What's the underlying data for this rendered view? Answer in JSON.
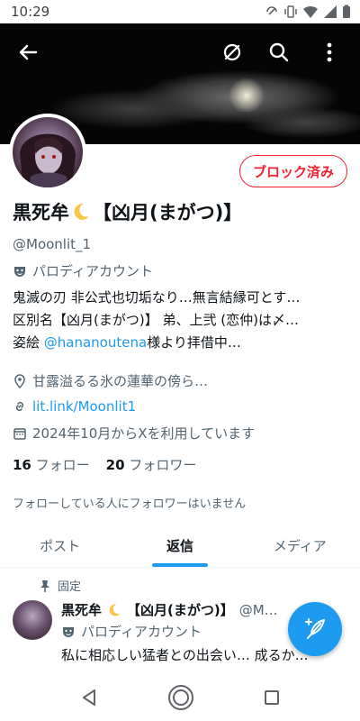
{
  "status_bar": {
    "time": "10:29",
    "icons": [
      "nfc-icon",
      "vibrate-icon",
      "wifi-icon",
      "signal-icon",
      "battery-icon"
    ]
  },
  "header": {
    "back_icon": "back-arrow-icon",
    "actions": [
      "hide-icon",
      "search-icon",
      "more-vert-icon"
    ]
  },
  "profile": {
    "block_button_label": "ブロック済み",
    "name": "黒死牟",
    "name_suffix": "【凶月(まがつ)】",
    "handle": "@Moonlit_1",
    "parody_label": "パロディアカウント",
    "bio_lines": [
      "鬼滅の刃  非公式也切垢なり…無言結縁可とす…",
      "区別名【凶月(まがつ)】 弟、上弐 (恋仲)は〆…"
    ],
    "bio_line3_prefix": "姿絵 ",
    "bio_line3_link": "@hananoutena",
    "bio_line3_suffix": "様より拝借中…",
    "location": "甘露溢るる氷の蓮華の傍ら…",
    "website": "lit.link/Moonlit1",
    "joined": "2024年10月からXを利用しています",
    "following_count": "16",
    "following_label": "フォロー",
    "followers_count": "20",
    "followers_label": "フォロワー",
    "no_mutual_followers": "フォローしている人にフォロワーはいません"
  },
  "tabs": [
    {
      "label": "ポスト",
      "active": false
    },
    {
      "label": "返信",
      "active": true
    },
    {
      "label": "メディア",
      "active": false
    }
  ],
  "pinned_tweet": {
    "pinned_label": "固定",
    "author_name": "黒死牟",
    "author_suffix": "【凶月(まがつ)】",
    "author_handle": "@M…",
    "parody_label": "パロディアカウント",
    "body": "私に相応しい猛者との出会い… 成るか…"
  },
  "colors": {
    "accent": "#1d9bf0",
    "block_red": "#f4212e",
    "secondary_text": "#536471"
  }
}
